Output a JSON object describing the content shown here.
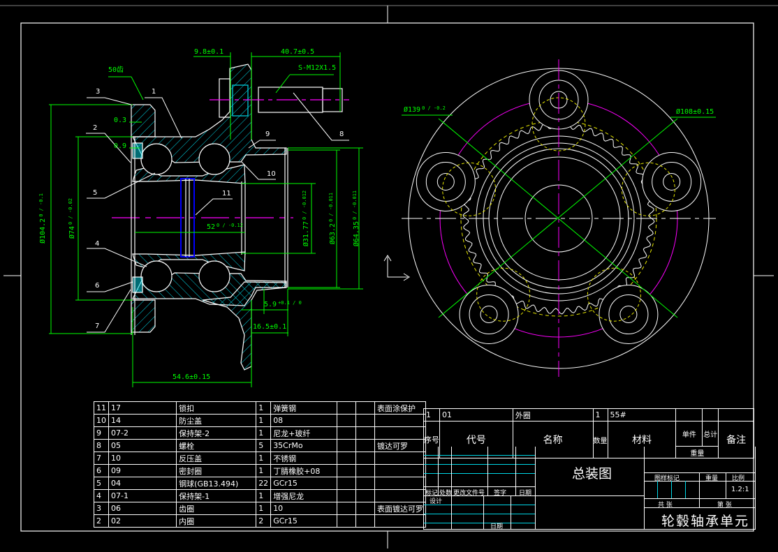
{
  "colors": {
    "background": "#000000",
    "outline": "#ffffff",
    "dimension": "#00ff00",
    "hatch": "#00d8e8",
    "centerline": "#ff00ff",
    "hidden": "#e8e800",
    "spacer": "#0000ff"
  },
  "dimensions": [
    {
      "main": "9.8±0.1",
      "tol": ""
    },
    {
      "main": "40.7±0.5",
      "tol": ""
    },
    {
      "main": "S-M12X1.5",
      "tol": ""
    },
    {
      "main": "50齿",
      "tol": ""
    },
    {
      "main": "0.3",
      "tol": ""
    },
    {
      "main": "0.9",
      "tol": ""
    },
    {
      "main": "52",
      "tol": "0 / -0.12"
    },
    {
      "main": "54.6±0.15",
      "tol": ""
    },
    {
      "main": "5.9",
      "tol": "+0.1 / 0"
    },
    {
      "main": "16.5±0.1",
      "tol": ""
    },
    {
      "main": "Ø104.2",
      "tol": "0 / -0.1"
    },
    {
      "main": "Ø74",
      "tol": "0 / -0.02"
    },
    {
      "main": "Ø31.77",
      "tol": "0 / -0.012"
    },
    {
      "main": "Ø63.2",
      "tol": "0 / -0.011"
    },
    {
      "main": "Ø64.35",
      "tol": "0 / -0.011"
    },
    {
      "main": "Ø139",
      "tol": "0 / -0.2"
    },
    {
      "main": "Ø108±0.15",
      "tol": ""
    }
  ],
  "balloons": [
    "3",
    "1",
    "2",
    "5",
    "9",
    "10",
    "11",
    "8",
    "4",
    "6",
    "7"
  ],
  "parts": [
    {
      "no": "11",
      "code": "17",
      "name": "锁扣",
      "qty": "1",
      "material": "弹簧钢",
      "remark": "表面涂保护"
    },
    {
      "no": "10",
      "code": "14",
      "name": "防尘盖",
      "qty": "1",
      "material": "08",
      "remark": ""
    },
    {
      "no": "9",
      "code": "07-2",
      "name": "保持架-2",
      "qty": "1",
      "material": "尼龙+玻纤",
      "remark": ""
    },
    {
      "no": "8",
      "code": "05",
      "name": "螺栓",
      "qty": "5",
      "material": "35CrMo",
      "remark": "镀达可罗"
    },
    {
      "no": "7",
      "code": "10",
      "name": "反压盖",
      "qty": "1",
      "material": "不锈钢",
      "remark": ""
    },
    {
      "no": "6",
      "code": "09",
      "name": "密封圈",
      "qty": "1",
      "material": "丁腈橡胶+08",
      "remark": ""
    },
    {
      "no": "5",
      "code": "04",
      "name": "钢球(GB13.494)",
      "qty": "22",
      "material": "GCr15",
      "remark": ""
    },
    {
      "no": "4",
      "code": "07-1",
      "name": "保持架-1",
      "qty": "1",
      "material": "增强尼龙",
      "remark": ""
    },
    {
      "no": "3",
      "code": "06",
      "name": "齿圈",
      "qty": "1",
      "material": "10",
      "remark": "表面镀达可罗"
    },
    {
      "no": "2",
      "code": "02",
      "name": "内圈",
      "qty": "2",
      "material": "GCr15",
      "remark": ""
    }
  ],
  "part1": {
    "no": "1",
    "code": "01",
    "name": "外圈",
    "qty": "1",
    "material": "55#"
  },
  "header": {
    "no": "序号",
    "code": "代号",
    "name": "名称",
    "qty": "数量",
    "material": "材料",
    "unit": "单件",
    "total": "总计",
    "weight": "重量",
    "remark": "备注"
  },
  "title_block": {
    "drawing_type": "总装图",
    "title": "轮毂轴承单元",
    "rev_labels": [
      "标记",
      "处数",
      "更改文件号",
      "签字",
      "日期"
    ],
    "design": "设计",
    "date": "日期",
    "stage_label": "图样标记",
    "weight_label": "重量",
    "scale_label": "比例",
    "scale": "1.2:1",
    "sheets_total": "共 张",
    "sheet_no": "第 张"
  }
}
